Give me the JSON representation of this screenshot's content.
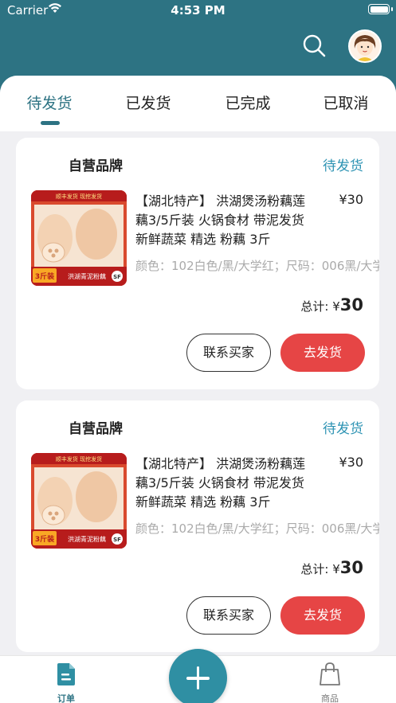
{
  "status_bar": {
    "carrier": "Carrier",
    "time": "4:53 PM"
  },
  "header": {
    "search_icon": "search-icon",
    "avatar_icon": "avatar-icon"
  },
  "tabs": [
    {
      "label": "待发货",
      "active": true
    },
    {
      "label": "已发货",
      "active": false
    },
    {
      "label": "已完成",
      "active": false
    },
    {
      "label": "已取消",
      "active": false
    }
  ],
  "orders": [
    {
      "shop": "自营品牌",
      "status": "待发货",
      "image_text_top": "顺丰发货 现挖发货",
      "image_text_bottom": "洪湖青泥粉藕",
      "image_badge": "3斤装",
      "image_logo": "SF",
      "title": "【湖北特产】 洪湖煲汤粉藕莲藕3/5斤装 火锅食材 带泥发货 新鲜蔬菜 精选 粉藕 3斤",
      "price": "¥30",
      "spec": "颜色：102白色/黑/大学红；尺码：006黑/大学",
      "total_label": "总计: ¥",
      "total_amount": "30",
      "contact_label": "联系买家",
      "ship_label": "去发货"
    },
    {
      "shop": "自营品牌",
      "status": "待发货",
      "image_text_top": "顺丰发货 现挖发货",
      "image_text_bottom": "洪湖青泥粉藕",
      "image_badge": "3斤装",
      "image_logo": "SF",
      "title": "【湖北特产】 洪湖煲汤粉藕莲藕3/5斤装 火锅食材 带泥发货 新鲜蔬菜 精选 粉藕 3斤",
      "price": "¥30",
      "spec": "颜色：102白色/黑/大学红；尺码：006黑/大学",
      "total_label": "总计: ¥",
      "total_amount": "30",
      "contact_label": "联系买家",
      "ship_label": "去发货"
    }
  ],
  "bottom_nav": [
    {
      "label": "订单",
      "icon": "document-icon",
      "active": true
    },
    {
      "label": "商品",
      "icon": "shopping-bag-icon",
      "active": false
    }
  ],
  "fab_icon": "plus-icon",
  "colors": {
    "primary": "#2d7383",
    "accent_red": "#e64545",
    "status_blue": "#2d93b3"
  }
}
